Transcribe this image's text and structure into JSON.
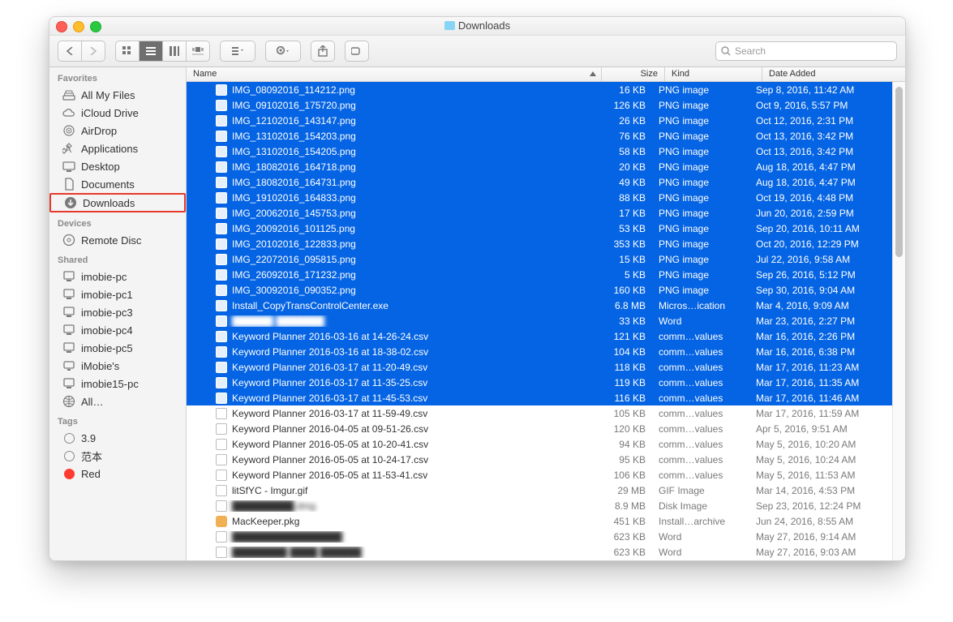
{
  "window": {
    "title": "Downloads"
  },
  "toolbar": {
    "search_placeholder": "Search"
  },
  "columns": {
    "name": "Name",
    "size": "Size",
    "kind": "Kind",
    "date": "Date Added"
  },
  "sidebar": {
    "sections": [
      {
        "title": "Favorites",
        "items": [
          {
            "id": "all-my-files",
            "label": "All My Files",
            "icon": "stack"
          },
          {
            "id": "icloud-drive",
            "label": "iCloud Drive",
            "icon": "cloud"
          },
          {
            "id": "airdrop",
            "label": "AirDrop",
            "icon": "airdrop"
          },
          {
            "id": "applications",
            "label": "Applications",
            "icon": "apps"
          },
          {
            "id": "desktop",
            "label": "Desktop",
            "icon": "desktop"
          },
          {
            "id": "documents",
            "label": "Documents",
            "icon": "doc"
          },
          {
            "id": "downloads",
            "label": "Downloads",
            "icon": "download",
            "selected": true
          }
        ]
      },
      {
        "title": "Devices",
        "items": [
          {
            "id": "remote-disc",
            "label": "Remote Disc",
            "icon": "disc"
          }
        ]
      },
      {
        "title": "Shared",
        "items": [
          {
            "id": "imobie-pc",
            "label": "imobie-pc",
            "icon": "pc"
          },
          {
            "id": "imobie-pc1",
            "label": "imobie-pc1",
            "icon": "pc"
          },
          {
            "id": "imobie-pc3",
            "label": "imobie-pc3",
            "icon": "pc"
          },
          {
            "id": "imobie-pc4",
            "label": "imobie-pc4",
            "icon": "pc"
          },
          {
            "id": "imobie-pc5",
            "label": "imobie-pc5",
            "icon": "pc"
          },
          {
            "id": "imobies",
            "label": "iMobie's",
            "icon": "mac"
          },
          {
            "id": "imobie15-pc",
            "label": "imobie15-pc",
            "icon": "pc"
          },
          {
            "id": "all-shared",
            "label": "All…",
            "icon": "globe"
          }
        ]
      },
      {
        "title": "Tags",
        "items": [
          {
            "id": "tag-3-9",
            "label": "3.9",
            "color": ""
          },
          {
            "id": "tag-fanben",
            "label": "范本",
            "color": ""
          },
          {
            "id": "tag-red",
            "label": "Red",
            "color": "red"
          }
        ]
      }
    ]
  },
  "files": [
    {
      "name": "IMG_08092016_114212.png",
      "size": "16 KB",
      "kind": "PNG image",
      "date": "Sep 8, 2016, 11:42 AM",
      "selected": true,
      "icon": "png"
    },
    {
      "name": "IMG_09102016_175720.png",
      "size": "126 KB",
      "kind": "PNG image",
      "date": "Oct 9, 2016, 5:57 PM",
      "selected": true,
      "icon": "png"
    },
    {
      "name": "IMG_12102016_143147.png",
      "size": "26 KB",
      "kind": "PNG image",
      "date": "Oct 12, 2016, 2:31 PM",
      "selected": true,
      "icon": "png"
    },
    {
      "name": "IMG_13102016_154203.png",
      "size": "76 KB",
      "kind": "PNG image",
      "date": "Oct 13, 2016, 3:42 PM",
      "selected": true,
      "icon": "png"
    },
    {
      "name": "IMG_13102016_154205.png",
      "size": "58 KB",
      "kind": "PNG image",
      "date": "Oct 13, 2016, 3:42 PM",
      "selected": true,
      "icon": "png"
    },
    {
      "name": "IMG_18082016_164718.png",
      "size": "20 KB",
      "kind": "PNG image",
      "date": "Aug 18, 2016, 4:47 PM",
      "selected": true,
      "icon": "png"
    },
    {
      "name": "IMG_18082016_164731.png",
      "size": "49 KB",
      "kind": "PNG image",
      "date": "Aug 18, 2016, 4:47 PM",
      "selected": true,
      "icon": "png"
    },
    {
      "name": "IMG_19102016_164833.png",
      "size": "88 KB",
      "kind": "PNG image",
      "date": "Oct 19, 2016, 4:48 PM",
      "selected": true,
      "icon": "png"
    },
    {
      "name": "IMG_20062016_145753.png",
      "size": "17 KB",
      "kind": "PNG image",
      "date": "Jun 20, 2016, 2:59 PM",
      "selected": true,
      "icon": "png"
    },
    {
      "name": "IMG_20092016_101125.png",
      "size": "53 KB",
      "kind": "PNG image",
      "date": "Sep 20, 2016, 10:11 AM",
      "selected": true,
      "icon": "png"
    },
    {
      "name": "IMG_20102016_122833.png",
      "size": "353 KB",
      "kind": "PNG image",
      "date": "Oct 20, 2016, 12:29 PM",
      "selected": true,
      "icon": "png"
    },
    {
      "name": "IMG_22072016_095815.png",
      "size": "15 KB",
      "kind": "PNG image",
      "date": "Jul 22, 2016, 9:58 AM",
      "selected": true,
      "icon": "png"
    },
    {
      "name": "IMG_26092016_171232.png",
      "size": "5 KB",
      "kind": "PNG image",
      "date": "Sep 26, 2016, 5:12 PM",
      "selected": true,
      "icon": "png"
    },
    {
      "name": "IMG_30092016_090352.png",
      "size": "160 KB",
      "kind": "PNG image",
      "date": "Sep 30, 2016, 9:04 AM",
      "selected": true,
      "icon": "png"
    },
    {
      "name": "Install_CopyTransControlCenter.exe",
      "size": "6.8 MB",
      "kind": "Micros…ication",
      "date": "Mar 4, 2016, 9:09 AM",
      "selected": true,
      "icon": "exe"
    },
    {
      "name": "██████ ███████",
      "size": "33 KB",
      "kind": "Word",
      "date": "Mar 23, 2016, 2:27 PM",
      "selected": true,
      "icon": "doc",
      "blur": true
    },
    {
      "name": "Keyword Planner 2016-03-16 at 14-26-24.csv",
      "size": "121 KB",
      "kind": "comm…values",
      "date": "Mar 16, 2016, 2:26 PM",
      "selected": true,
      "icon": "csv"
    },
    {
      "name": "Keyword Planner 2016-03-16 at 18-38-02.csv",
      "size": "104 KB",
      "kind": "comm…values",
      "date": "Mar 16, 2016, 6:38 PM",
      "selected": true,
      "icon": "csv"
    },
    {
      "name": "Keyword Planner 2016-03-17 at 11-20-49.csv",
      "size": "118 KB",
      "kind": "comm…values",
      "date": "Mar 17, 2016, 11:23 AM",
      "selected": true,
      "icon": "csv"
    },
    {
      "name": "Keyword Planner 2016-03-17 at 11-35-25.csv",
      "size": "119 KB",
      "kind": "comm…values",
      "date": "Mar 17, 2016, 11:35 AM",
      "selected": true,
      "icon": "csv"
    },
    {
      "name": "Keyword Planner 2016-03-17 at 11-45-53.csv",
      "size": "116 KB",
      "kind": "comm…values",
      "date": "Mar 17, 2016, 11:46 AM",
      "selected": true,
      "icon": "csv"
    },
    {
      "name": "Keyword Planner 2016-03-17 at 11-59-49.csv",
      "size": "105 KB",
      "kind": "comm…values",
      "date": "Mar 17, 2016, 11:59 AM",
      "selected": false,
      "icon": "csv"
    },
    {
      "name": "Keyword Planner 2016-04-05 at 09-51-26.csv",
      "size": "120 KB",
      "kind": "comm…values",
      "date": "Apr 5, 2016, 9:51 AM",
      "selected": false,
      "icon": "csv"
    },
    {
      "name": "Keyword Planner 2016-05-05 at 10-20-41.csv",
      "size": "94 KB",
      "kind": "comm…values",
      "date": "May 5, 2016, 10:20 AM",
      "selected": false,
      "icon": "csv"
    },
    {
      "name": "Keyword Planner 2016-05-05 at 10-24-17.csv",
      "size": "95 KB",
      "kind": "comm…values",
      "date": "May 5, 2016, 10:24 AM",
      "selected": false,
      "icon": "csv"
    },
    {
      "name": "Keyword Planner 2016-05-05 at 11-53-41.csv",
      "size": "106 KB",
      "kind": "comm…values",
      "date": "May 5, 2016, 11:53 AM",
      "selected": false,
      "icon": "csv"
    },
    {
      "name": "litSfYC - Imgur.gif",
      "size": "29 MB",
      "kind": "GIF Image",
      "date": "Mar 14, 2016, 4:53 PM",
      "selected": false,
      "icon": "gif"
    },
    {
      "name": "█████████.dmg",
      "size": "8.9 MB",
      "kind": "Disk Image",
      "date": "Sep 23, 2016, 12:24 PM",
      "selected": false,
      "icon": "dmg",
      "blur": true
    },
    {
      "name": "MacKeeper.pkg",
      "size": "451 KB",
      "kind": "Install…archive",
      "date": "Jun 24, 2016, 8:55 AM",
      "selected": false,
      "icon": "pkg"
    },
    {
      "name": "████████████████",
      "size": "623 KB",
      "kind": "Word",
      "date": "May 27, 2016, 9:14 AM",
      "selected": false,
      "icon": "doc",
      "blur": true
    },
    {
      "name": "████████ ████ ██████",
      "size": "623 KB",
      "kind": "Word",
      "date": "May 27, 2016, 9:03 AM",
      "selected": false,
      "icon": "doc",
      "blur": true
    }
  ]
}
